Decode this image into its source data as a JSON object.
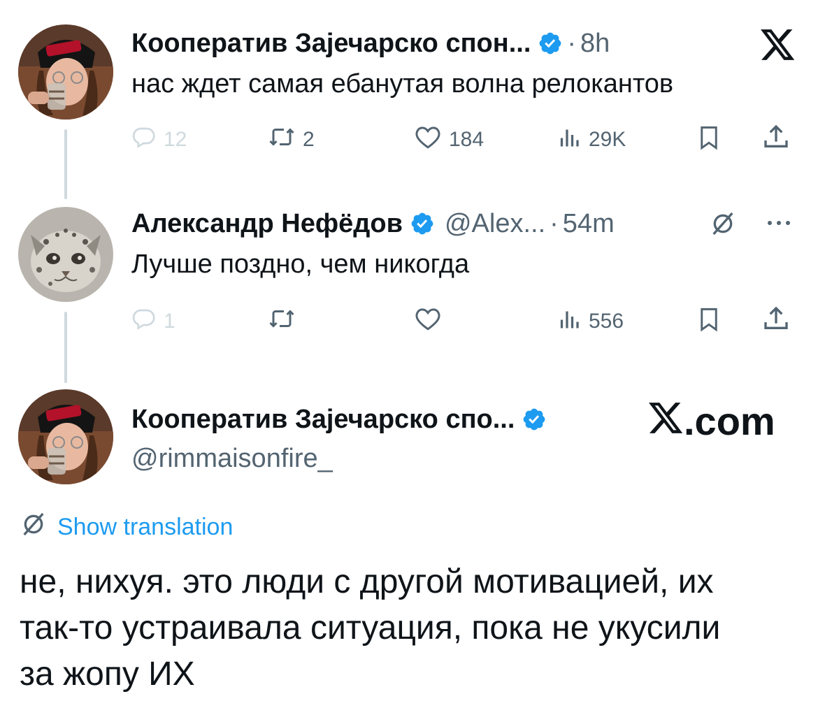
{
  "tweets": [
    {
      "author_name": "Кооператив Зајечарско спон...",
      "meta_separator": "·",
      "time": "8h",
      "text": "нас ждет самая ебанутая волна релокантов",
      "stats": {
        "replies": "12",
        "reposts": "2",
        "likes": "184",
        "views": "29K"
      }
    },
    {
      "author_name": "Александр Нефёдов",
      "handle": "@Alex...",
      "meta_separator": "·",
      "time": "54m",
      "text": "Лучше поздно, чем никогда",
      "stats": {
        "replies": "1",
        "reposts": "",
        "likes": "",
        "views": "556"
      }
    }
  ],
  "quoted": {
    "author_name": "Кооператив Зајечарско спо...",
    "handle": "@rimmaisonfire_",
    "brand": ".com",
    "show_translation": "Show translation",
    "body_lines": [
      "не, нихуя. это люди с другой мотивацией, их",
      "так-то устраивала ситуация, пока не укусили",
      "за жопу ИХ"
    ]
  },
  "icons": {
    "verified": "verified-badge-icon",
    "reply": "reply-icon",
    "repost": "repost-icon",
    "like": "like-icon",
    "views": "views-icon",
    "bookmark": "bookmark-icon",
    "share": "share-icon",
    "translate": "translate-icon",
    "more": "more-icon",
    "x_logo": "x-logo-icon"
  },
  "colors": {
    "text": "#0f1419",
    "muted": "#536471",
    "faded": "#cfd9de",
    "accent": "#1d9bf0",
    "verified": "#1d9bf0"
  }
}
